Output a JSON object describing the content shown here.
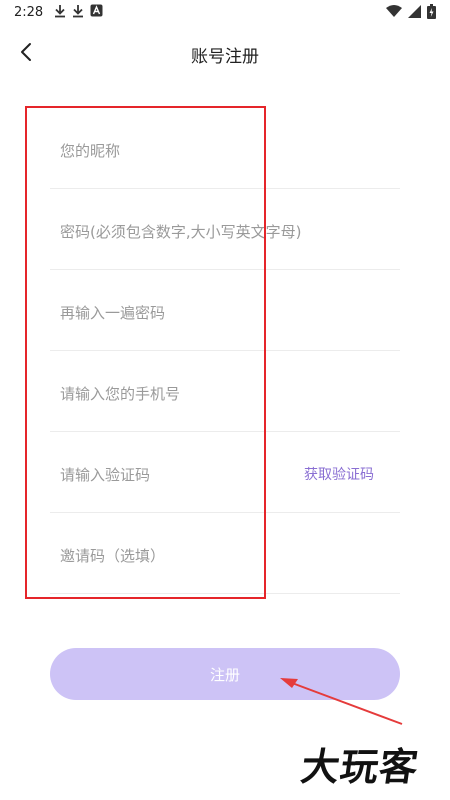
{
  "status_bar": {
    "time": "2:28",
    "left_icons": [
      "download-icon",
      "download-icon",
      "a-icon"
    ],
    "right_icons": [
      "wifi-icon",
      "signal-icon",
      "battery-icon"
    ]
  },
  "header": {
    "title": "账号注册",
    "back_icon": "chevron-left-icon"
  },
  "form": {
    "nickname_placeholder": "您的昵称",
    "password_placeholder": "密码(必须包含数字,大小写英文字母)",
    "confirm_password_placeholder": "再输入一遍密码",
    "phone_placeholder": "请输入您的手机号",
    "code_placeholder": "请输入验证码",
    "get_code_label": "获取验证码",
    "invite_placeholder": "邀请码（选填）"
  },
  "register_label": "注册",
  "watermark": "大玩客",
  "colors": {
    "accent": "#8a6fd3",
    "button_bg": "#cdc3f6",
    "highlight_box": "#e5252a",
    "arrow": "#e53b3b"
  }
}
